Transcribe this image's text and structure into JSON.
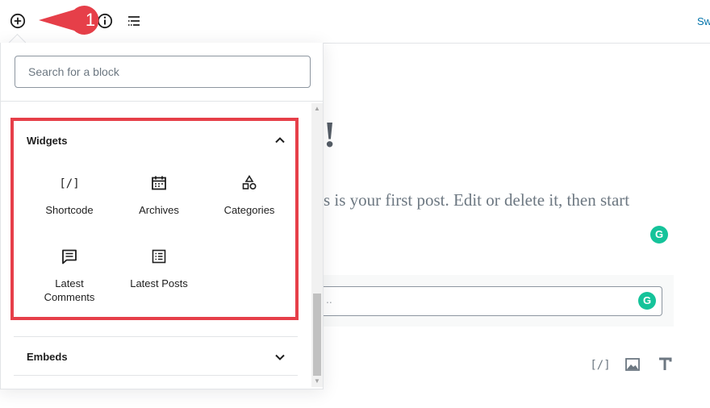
{
  "toolbar": {
    "add_block_icon": "plus-circle-icon",
    "info_icon": "info-icon",
    "outline_icon": "list-outline-icon",
    "switch_link": "Sw"
  },
  "callout": {
    "number": "1",
    "color": "#e63f49"
  },
  "editor": {
    "title_fragment": "!",
    "body_fragment": "s is your first post. Edit or delete it, then start",
    "grammarly_badge": "G",
    "input_fragment": "..",
    "inserter_icons": [
      "shortcode-icon",
      "image-icon",
      "heading-icon"
    ]
  },
  "inserter": {
    "search_placeholder": "Search for a block",
    "widgets_panel": {
      "title": "Widgets",
      "highlight_color": "#e63f49",
      "blocks": [
        {
          "label": "Shortcode",
          "icon": "shortcode-icon"
        },
        {
          "label": "Archives",
          "icon": "calendar-icon"
        },
        {
          "label": "Categories",
          "icon": "shapes-icon"
        },
        {
          "label": "Latest\nComments",
          "icon": "comment-icon"
        },
        {
          "label": "Latest Posts",
          "icon": "list-icon"
        }
      ]
    },
    "embeds_panel": {
      "title": "Embeds"
    }
  }
}
